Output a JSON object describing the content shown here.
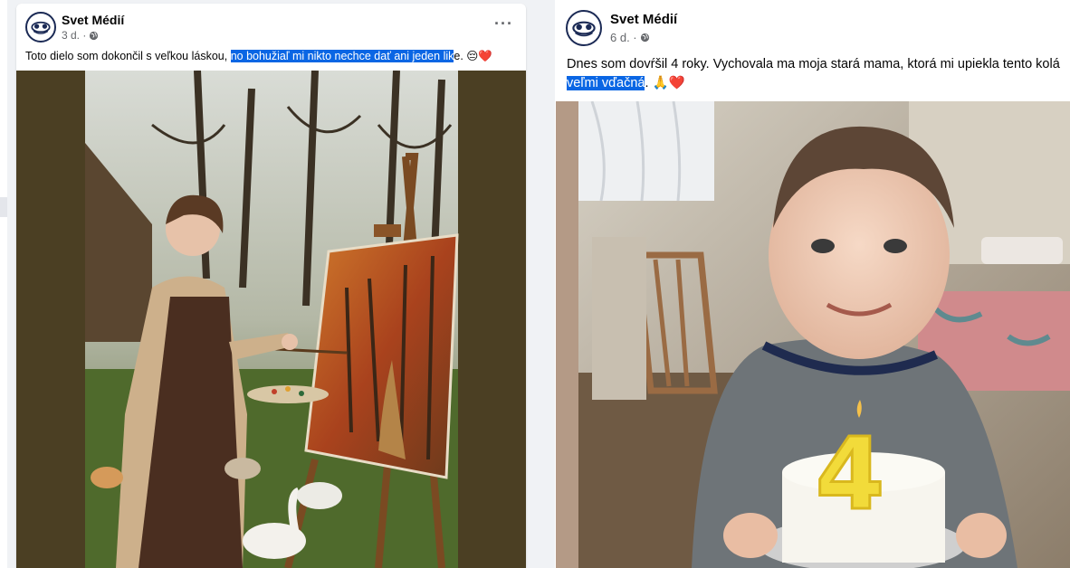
{
  "posts": [
    {
      "author": "Svet Médií",
      "time": "3 d. ·",
      "caption_before": "Toto dielo som dokončil s veľkou láskou, ",
      "caption_highlight": "no bohužiaľ mi nikto nechce dať ani jeden lik",
      "caption_after": "e. ",
      "caption_emoji": "😔❤️",
      "more_label": "···",
      "image": "painting-woman-crying-easel-geese"
    },
    {
      "author": "Svet Médií",
      "time": "6 d. ·",
      "caption_line1": "Dnes som dovŕšil 4 roky. Vychovala ma moja stará mama, ktorá mi upiekla tento kolá",
      "caption_highlight": "veľmi vďačná",
      "caption_after": ". ",
      "caption_emoji": "🙏❤️",
      "image": "boy-with-birthday-cake-4",
      "cake_number": "4"
    }
  ],
  "icons": {
    "globe": "globe-icon",
    "more": "more-options-icon",
    "avatar": "svet-medii-logo"
  },
  "colors": {
    "highlight": "#0a66e4",
    "meta_text": "#65676b",
    "page_bg": "#f0f2f5"
  }
}
